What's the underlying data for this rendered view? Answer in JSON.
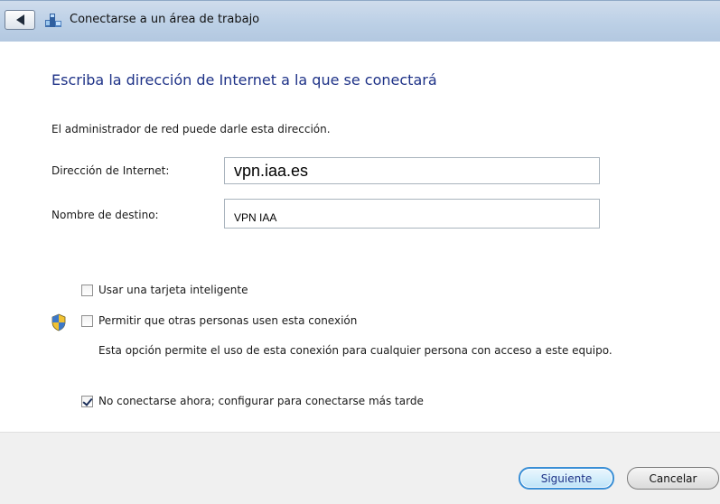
{
  "window": {
    "title": "Conectarse a un área de trabajo"
  },
  "main": {
    "heading": "Escriba la dirección de Internet a la que se conectará",
    "hint": "El administrador de red puede darle esta dirección.",
    "internet_address": {
      "label": "Dirección de Internet:",
      "value": "vpn.iaa.es"
    },
    "destination_name": {
      "label": "Nombre de destino:",
      "value": "VPN IAA"
    },
    "options": {
      "smart_card": {
        "label": "Usar una tarjeta inteligente",
        "checked": false
      },
      "allow_others": {
        "label": "Permitir que otras personas usen esta conexión",
        "checked": false,
        "icon": "uac-shield-icon"
      },
      "allow_others_desc": "Esta opción permite el uso de esta conexión para cualquier persona con acceso a este equipo.",
      "connect_later": {
        "label": "No conectarse ahora; configurar para conectarse más tarde",
        "checked": true
      }
    }
  },
  "footer": {
    "next_label": "Siguiente",
    "cancel_label": "Cancelar"
  },
  "colors": {
    "heading": "#1e3287",
    "titlebar": "#bcd0e6",
    "footer": "#f0f0f0",
    "primary_button_border": "#3a8fd6"
  }
}
